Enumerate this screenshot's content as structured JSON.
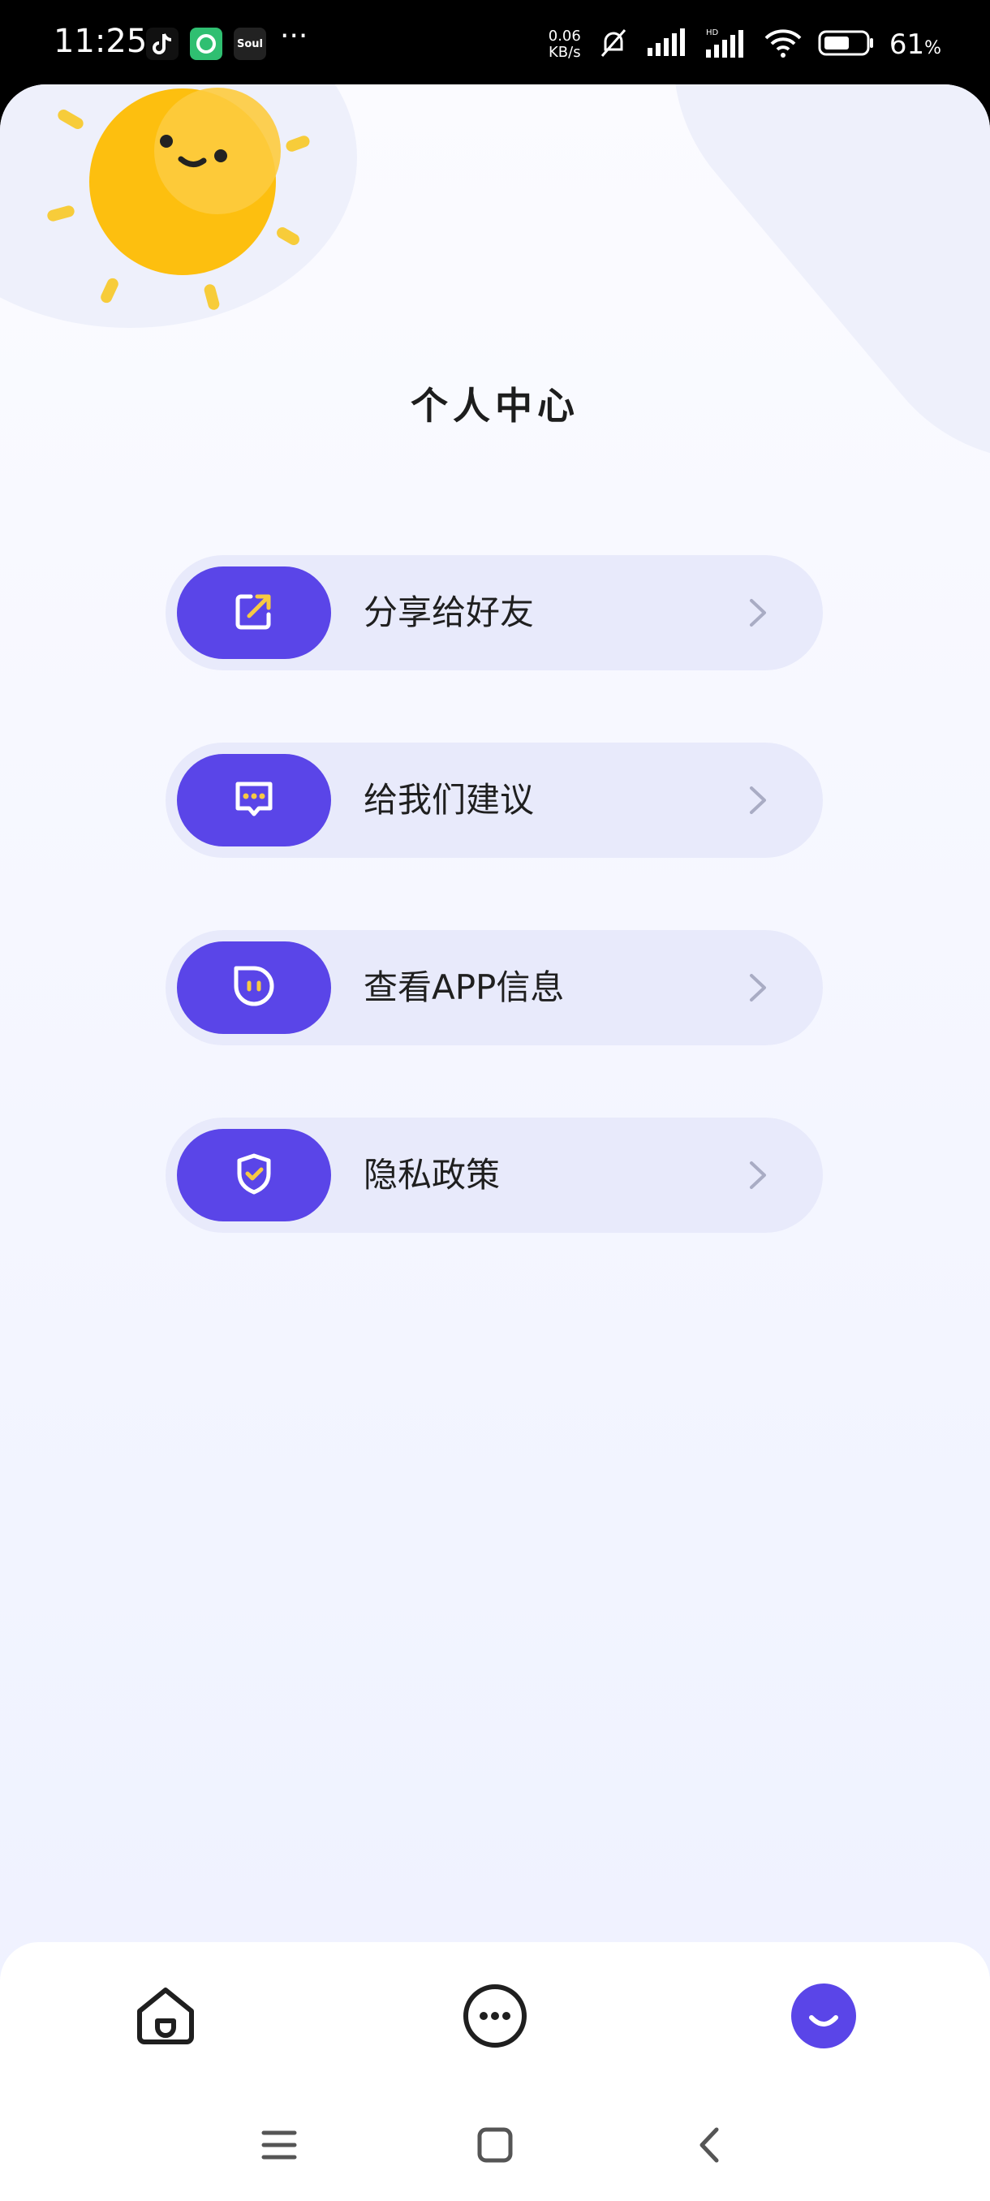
{
  "status_bar": {
    "time": "11:25",
    "net_speed_value": "0.06",
    "net_speed_unit": "KB/s",
    "battery_percent": "61",
    "battery_suffix": "%",
    "app_icons": [
      "tiktok-icon",
      "green-app-icon",
      "soul-icon"
    ],
    "soul_label": "Soul",
    "more_indicator": "···"
  },
  "page": {
    "title": "个人中心"
  },
  "menu": [
    {
      "label": "分享给好友",
      "icon": "share-icon"
    },
    {
      "label": "给我们建议",
      "icon": "feedback-icon"
    },
    {
      "label": "查看APP信息",
      "icon": "app-info-icon"
    },
    {
      "label": "隐私政策",
      "icon": "privacy-shield-icon"
    }
  ],
  "bottom_nav": {
    "items": [
      {
        "icon": "home-icon",
        "active": false
      },
      {
        "icon": "chat-icon",
        "active": false
      },
      {
        "icon": "profile-smile-icon",
        "active": true
      }
    ],
    "accent_color": "#5a45e8"
  },
  "system_nav": [
    "menu-icon",
    "home-square-icon",
    "back-icon"
  ]
}
